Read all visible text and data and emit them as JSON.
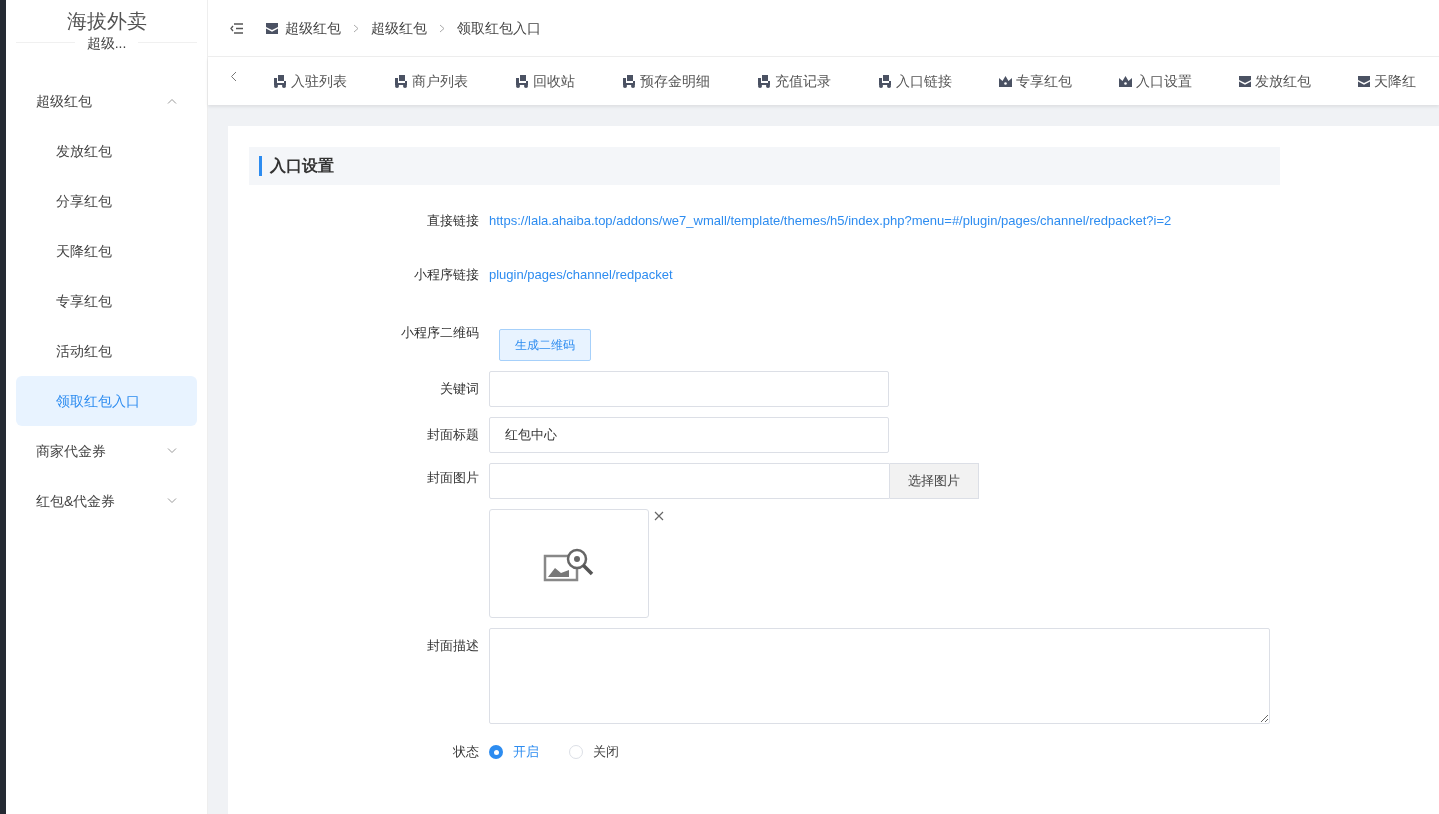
{
  "sidebar": {
    "brand": "海拔外卖",
    "subtitle": "超级...",
    "groups": [
      {
        "label": "超级红包",
        "expanded": true,
        "children": [
          {
            "label": "发放红包",
            "selected": false
          },
          {
            "label": "分享红包",
            "selected": false
          },
          {
            "label": "天降红包",
            "selected": false
          },
          {
            "label": "专享红包",
            "selected": false
          },
          {
            "label": "活动红包",
            "selected": false
          },
          {
            "label": "领取红包入口",
            "selected": true
          }
        ]
      },
      {
        "label": "商家代金券",
        "expanded": false
      },
      {
        "label": "红包&代金券",
        "expanded": false
      }
    ]
  },
  "breadcrumb": [
    "超级红包",
    "超级红包",
    "领取红包入口"
  ],
  "tabs": [
    {
      "label": "入驻列表",
      "kind": "scooter"
    },
    {
      "label": "商户列表",
      "kind": "scooter"
    },
    {
      "label": "回收站",
      "kind": "scooter"
    },
    {
      "label": "预存金明细",
      "kind": "scooter"
    },
    {
      "label": "充值记录",
      "kind": "scooter"
    },
    {
      "label": "入口链接",
      "kind": "scooter"
    },
    {
      "label": "专享红包",
      "kind": "crown"
    },
    {
      "label": "入口设置",
      "kind": "crown"
    },
    {
      "label": "发放红包",
      "kind": "envelope"
    },
    {
      "label": "天降红",
      "kind": "envelope"
    }
  ],
  "section_title": "入口设置",
  "form": [
    {
      "kind": "link",
      "label": "直接链接",
      "value": "https://lala.ahaiba.top/addons/we7_wmall/template/themes/h5/index.php?menu=#/plugin/pages/channel/redpacket?i=2"
    },
    {
      "kind": "link",
      "label": "小程序链接",
      "value": "plugin/pages/channel/redpacket"
    },
    {
      "kind": "button",
      "label": "小程序二维码",
      "button": "生成二维码"
    },
    {
      "kind": "input",
      "label": "关键词"
    },
    {
      "kind": "input",
      "label": "封面标题",
      "value": "红包中心"
    },
    {
      "kind": "image",
      "label": "封面图片",
      "button": "选择图片"
    },
    {
      "kind": "textarea",
      "label": "封面描述"
    },
    {
      "kind": "radio",
      "label": "状态",
      "options": [
        {
          "label": "开启",
          "selected": true
        },
        {
          "label": "关闭",
          "selected": false
        }
      ]
    }
  ]
}
